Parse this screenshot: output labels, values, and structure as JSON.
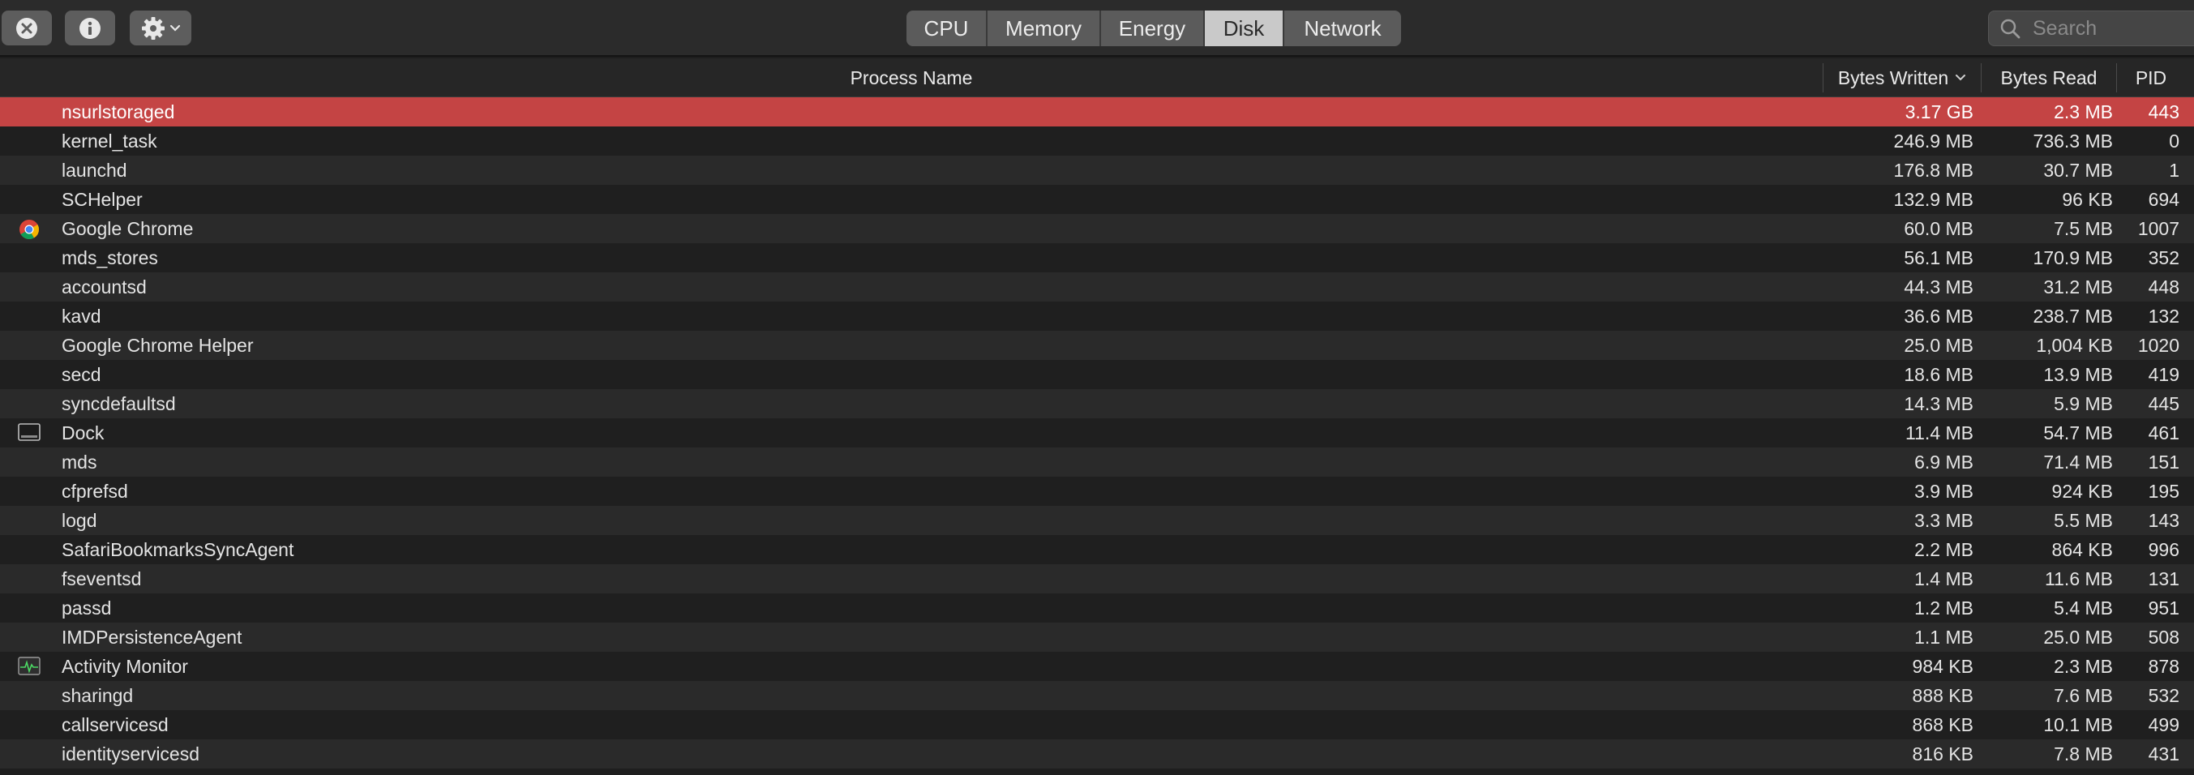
{
  "toolbar": {
    "tabs": [
      {
        "label": "CPU",
        "active": false
      },
      {
        "label": "Memory",
        "active": false
      },
      {
        "label": "Energy",
        "active": false
      },
      {
        "label": "Disk",
        "active": true
      },
      {
        "label": "Network",
        "active": false
      }
    ],
    "search_placeholder": "Search",
    "icons": [
      "close-process-icon",
      "info-icon",
      "gear-icon",
      "chevron-down-icon",
      "search-icon"
    ]
  },
  "table": {
    "columns": {
      "process_name": "Process Name",
      "bytes_written": "Bytes Written",
      "bytes_read": "Bytes Read",
      "pid": "PID"
    },
    "sort_column": "bytes_written",
    "rows": [
      {
        "name": "nsurlstoraged",
        "bytes_written": "3.17 GB",
        "bytes_read": "2.3 MB",
        "pid": "443",
        "icon": "",
        "selected": true
      },
      {
        "name": "kernel_task",
        "bytes_written": "246.9 MB",
        "bytes_read": "736.3 MB",
        "pid": "0",
        "icon": ""
      },
      {
        "name": "launchd",
        "bytes_written": "176.8 MB",
        "bytes_read": "30.7 MB",
        "pid": "1",
        "icon": ""
      },
      {
        "name": "SCHelper",
        "bytes_written": "132.9 MB",
        "bytes_read": "96 KB",
        "pid": "694",
        "icon": ""
      },
      {
        "name": "Google Chrome",
        "bytes_written": "60.0 MB",
        "bytes_read": "7.5 MB",
        "pid": "1007",
        "icon": "chrome-icon"
      },
      {
        "name": "mds_stores",
        "bytes_written": "56.1 MB",
        "bytes_read": "170.9 MB",
        "pid": "352",
        "icon": ""
      },
      {
        "name": "accountsd",
        "bytes_written": "44.3 MB",
        "bytes_read": "31.2 MB",
        "pid": "448",
        "icon": ""
      },
      {
        "name": "kavd",
        "bytes_written": "36.6 MB",
        "bytes_read": "238.7 MB",
        "pid": "132",
        "icon": ""
      },
      {
        "name": "Google Chrome Helper",
        "bytes_written": "25.0 MB",
        "bytes_read": "1,004 KB",
        "pid": "1020",
        "icon": ""
      },
      {
        "name": "secd",
        "bytes_written": "18.6 MB",
        "bytes_read": "13.9 MB",
        "pid": "419",
        "icon": ""
      },
      {
        "name": "syncdefaultsd",
        "bytes_written": "14.3 MB",
        "bytes_read": "5.9 MB",
        "pid": "445",
        "icon": ""
      },
      {
        "name": "Dock",
        "bytes_written": "11.4 MB",
        "bytes_read": "54.7 MB",
        "pid": "461",
        "icon": "dock-icon"
      },
      {
        "name": "mds",
        "bytes_written": "6.9 MB",
        "bytes_read": "71.4 MB",
        "pid": "151",
        "icon": ""
      },
      {
        "name": "cfprefsd",
        "bytes_written": "3.9 MB",
        "bytes_read": "924 KB",
        "pid": "195",
        "icon": ""
      },
      {
        "name": "logd",
        "bytes_written": "3.3 MB",
        "bytes_read": "5.5 MB",
        "pid": "143",
        "icon": ""
      },
      {
        "name": "SafariBookmarksSyncAgent",
        "bytes_written": "2.2 MB",
        "bytes_read": "864 KB",
        "pid": "996",
        "icon": ""
      },
      {
        "name": "fseventsd",
        "bytes_written": "1.4 MB",
        "bytes_read": "11.6 MB",
        "pid": "131",
        "icon": ""
      },
      {
        "name": "passd",
        "bytes_written": "1.2 MB",
        "bytes_read": "5.4 MB",
        "pid": "951",
        "icon": ""
      },
      {
        "name": "IMDPersistenceAgent",
        "bytes_written": "1.1 MB",
        "bytes_read": "25.0 MB",
        "pid": "508",
        "icon": ""
      },
      {
        "name": "Activity Monitor",
        "bytes_written": "984 KB",
        "bytes_read": "2.3 MB",
        "pid": "878",
        "icon": "activity-monitor-icon"
      },
      {
        "name": "sharingd",
        "bytes_written": "888 KB",
        "bytes_read": "7.6 MB",
        "pid": "532",
        "icon": ""
      },
      {
        "name": "callservicesd",
        "bytes_written": "868 KB",
        "bytes_read": "10.1 MB",
        "pid": "499",
        "icon": ""
      },
      {
        "name": "identityservicesd",
        "bytes_written": "816 KB",
        "bytes_read": "7.8 MB",
        "pid": "431",
        "icon": ""
      }
    ]
  },
  "colors": {
    "selected_row": "#c44444",
    "active_tab": "#c9c9c9"
  }
}
